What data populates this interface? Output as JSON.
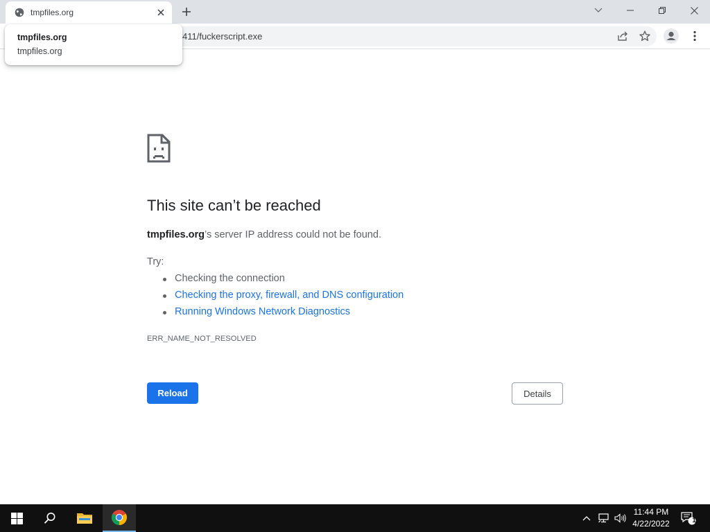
{
  "browser": {
    "tab": {
      "title": "tmpfiles.org",
      "favicon": "globe-icon"
    },
    "new_tab_icon": "plus-icon",
    "window_controls": [
      "tab-search-icon",
      "minimize-icon",
      "restore-icon",
      "close-icon"
    ],
    "omnibox": {
      "visible_url": "411/fuckerscript.exe"
    },
    "toolbar_icons": [
      "share-icon",
      "star-icon",
      "profile-icon",
      "kebab-menu-icon"
    ],
    "hover_card": {
      "title": "tmpfiles.org",
      "domain": "tmpfiles.org"
    }
  },
  "error_page": {
    "icon": "sad-document-icon",
    "title": "This site can’t be reached",
    "host": "tmpfiles.org",
    "description_suffix": "’s server IP address could not be found.",
    "try_label": "Try:",
    "suggestions": [
      {
        "text": "Checking the connection",
        "is_link": false
      },
      {
        "text": "Checking the proxy, firewall, and DNS configuration",
        "is_link": true
      },
      {
        "text": "Running Windows Network Diagnostics",
        "is_link": true
      }
    ],
    "error_code": "ERR_NAME_NOT_RESOLVED",
    "reload_label": "Reload",
    "details_label": "Details"
  },
  "taskbar": {
    "apps": [
      "windows-start-icon",
      "search-icon",
      "file-explorer-icon",
      "chrome-icon"
    ],
    "tray_icons": [
      "chevron-up-icon",
      "network-icon",
      "volume-icon"
    ],
    "time": "11:44 PM",
    "date": "4/22/2022",
    "notification_count": "1"
  },
  "colors": {
    "accent": "#1a73e8",
    "tabstrip_bg": "#dee1e6",
    "omnibox_bg": "#f1f3f4",
    "taskbar_bg": "#101010"
  }
}
